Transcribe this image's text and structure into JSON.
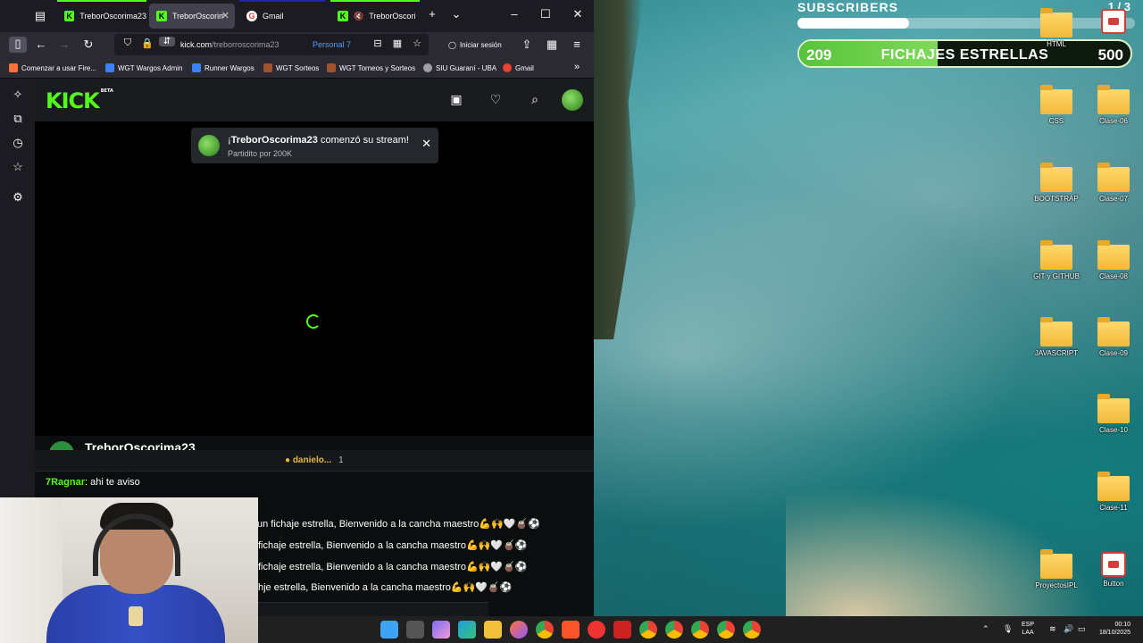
{
  "browser": {
    "tabs": [
      {
        "label": "TreborOscorima23",
        "icon": "kick",
        "active": false
      },
      {
        "label": "TreborOscorima23",
        "icon": "kick",
        "active": true
      },
      {
        "label": "Gmail",
        "icon": "gmail",
        "active": false
      },
      {
        "label": "TreborOscorima23",
        "icon": "kick",
        "active": false,
        "muted": true
      }
    ],
    "url_domain": "kick.com",
    "url_path": "/treborroscorima23",
    "container_label": "Personal 7",
    "signin_label": "Iniciar sesión",
    "bookmarks": [
      {
        "label": "Comenzar a usar Fire...",
        "color": "#ff7139"
      },
      {
        "label": "WGT Wargos Admin",
        "color": "#3b82f6"
      },
      {
        "label": "Runner Wargos",
        "color": "#3b82f6"
      },
      {
        "label": "WGT Sorteos",
        "color": "#a0522d"
      },
      {
        "label": "WGT Torneos y Sorteos",
        "color": "#a0522d"
      },
      {
        "label": "SIU Guaraní - UBA",
        "color": "#9e9ea6"
      },
      {
        "label": "Gmail",
        "color": "#ea4335"
      }
    ]
  },
  "kick": {
    "logo": "KICK",
    "logo_badge": "BETA",
    "toast": {
      "prefix": "¡",
      "streamer": "TreborOscorima23",
      "suffix": " comenzó su stream!",
      "subtitle": "Partidito por 200K"
    },
    "streamer_name": "TreborOscorima23",
    "pinned": {
      "user": "danielo...",
      "count": "1"
    },
    "chat": [
      {
        "user": "7Ragnar",
        "text": ": ahi te aviso"
      },
      {
        "text": "un fichaje estrella, Bienvenido a la cancha maestro💪🙌🤍🧉⚽"
      },
      {
        "text": "fichaje estrella, Bienvenido a la cancha maestro💪🙌🤍🧉⚽"
      },
      {
        "text": "fichaje estrella, Bienvenido a la cancha maestro💪🙌🤍🧉⚽"
      },
      {
        "text": "hje estrella, Bienvenido a la cancha maestro💪🙌🤍🧉⚽"
      }
    ]
  },
  "overlay": {
    "subs_label": "SUBSCRIBERS",
    "subs_count": "1 / 3",
    "subs_progress": 0.33,
    "goal_current": "209",
    "goal_title": "FICHAJES ESTRELLAS",
    "goal_target": "500",
    "goal_progress": 0.418
  },
  "desktop_icons": [
    {
      "label": "HTML",
      "type": "folder"
    },
    {
      "label": "",
      "type": "app"
    },
    {
      "label": "CSS",
      "type": "folder"
    },
    {
      "label": "Clase-06",
      "type": "folder"
    },
    {
      "label": "BOOTSTRAP",
      "type": "folder"
    },
    {
      "label": "Clase-07",
      "type": "folder"
    },
    {
      "label": "GIT y GITHUB",
      "type": "folder"
    },
    {
      "label": "Clase-08",
      "type": "folder"
    },
    {
      "label": "JAVASCRIPT",
      "type": "folder"
    },
    {
      "label": "Clase-09",
      "type": "folder"
    },
    {
      "label": "Clase-10",
      "type": "folder"
    },
    {
      "label": "Clase-11",
      "type": "folder"
    },
    {
      "label": "ProyectosIPL",
      "type": "folder"
    },
    {
      "label": "Button",
      "type": "app"
    }
  ],
  "taskbar": {
    "lang_top": "ESP",
    "lang_bottom": "LAA",
    "time": "00:10",
    "date": "18/10/2025"
  }
}
